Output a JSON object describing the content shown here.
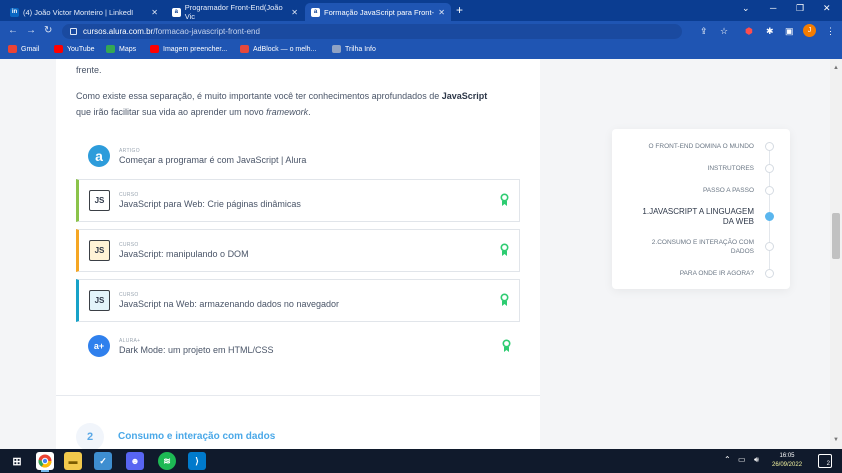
{
  "browser": {
    "tabs": [
      {
        "label": "(4) João Victor Monteiro | LinkedI",
        "icon": "linkedin-icon",
        "active": false
      },
      {
        "label": "Programador Front-End(João Vic",
        "icon": "alura-icon",
        "active": false
      },
      {
        "label": "Formação JavaScript para Front-",
        "icon": "alura-icon",
        "active": true
      }
    ],
    "new_tab": "+",
    "url_host": "cursos.alura.com.br",
    "url_path": "/formacao-javascript-front-end",
    "profile_initial": "J",
    "bookmarks": [
      {
        "label": "Gmail",
        "icon": "gmail-icon",
        "color": "#ea4335"
      },
      {
        "label": "YouTube",
        "icon": "youtube-icon",
        "color": "#ff0000"
      },
      {
        "label": "Maps",
        "icon": "maps-icon",
        "color": "#34a853"
      },
      {
        "label": "Imagem preencher...",
        "icon": "youtube-icon",
        "color": "#ff0000"
      },
      {
        "label": "AdBlock — o melh...",
        "icon": "adblock-icon",
        "color": "#e5483b"
      },
      {
        "label": "Trilha Info",
        "icon": "grid-icon",
        "color": "#8fa2c4"
      }
    ]
  },
  "article": {
    "intro_tail": "frente.",
    "para_start": "Como existe essa separação, é muito importante você ter conhecimentos aprofundados de ",
    "para_bold": "JavaScript",
    "para_line2_start": "que irão facilitar sua vida ao aprender um novo ",
    "para_italic": "framework",
    "para_end": ".",
    "artigo": {
      "kicker": "ARTIGO",
      "title": "Começar a programar é com JavaScript | Alura"
    },
    "courses": [
      {
        "kicker": "CURSO",
        "title": "JavaScript para Web: Crie páginas dinâmicas",
        "accent": "#8bc34a"
      },
      {
        "kicker": "CURSO",
        "title": "JavaScript: manipulando o DOM",
        "accent": "#f5a623"
      },
      {
        "kicker": "CURSO",
        "title": "JavaScript na Web: armazenando dados no navegador",
        "accent": "#17a2c8"
      }
    ],
    "alura_plus": {
      "kicker": "ALURA+",
      "title": "Dark Mode: um projeto em HTML/CSS"
    },
    "next_section": {
      "number": "2",
      "title": "Consumo e interação com dados"
    }
  },
  "toc": {
    "items": [
      {
        "label": "O FRONT-END DOMINA O MUNDO",
        "active": false
      },
      {
        "label": "INSTRUTORES",
        "active": false
      },
      {
        "label": "PASSO A PASSO",
        "active": false
      },
      {
        "label_line1": "1.JAVASCRIPT A LINGUAGEM",
        "label_line2": "DA WEB",
        "active": true
      },
      {
        "label_line1": "2.CONSUMO E INTERAÇÃO COM",
        "label_line2": "DADOS",
        "active": false
      },
      {
        "label": "PARA ONDE IR AGORA?",
        "active": false
      }
    ]
  },
  "taskbar": {
    "time": "16:05",
    "date": "26/09/2022",
    "notifications": "2"
  }
}
